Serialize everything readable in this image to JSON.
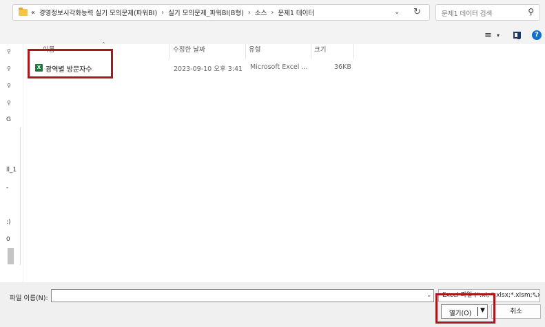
{
  "address": {
    "prefix": "«",
    "crumbs": [
      "경영정보시각화능력 실기 모의문제(파워BI)",
      "실기 모의문제_파워BI(B형)",
      "소스",
      "문제1 데이터"
    ],
    "separator": "›"
  },
  "search": {
    "placeholder": "문제1 데이터 검색"
  },
  "toolbar": {
    "view_icon": "≡",
    "dropdown": "▾",
    "help": "?"
  },
  "nav": {
    "pins": [
      "📌",
      "📌",
      "📌",
      "📌"
    ],
    "fragments": [
      "G",
      "ll_1",
      "-",
      ":)",
      "0"
    ]
  },
  "columns": [
    {
      "label": "이름"
    },
    {
      "label": "수정한 날짜"
    },
    {
      "label": "유형"
    },
    {
      "label": "크기"
    }
  ],
  "files": [
    {
      "name": "광역별 방문자수",
      "modified": "2023-09-10 오후 3:41",
      "type": "Microsoft Excel ...",
      "size": "36KB"
    }
  ],
  "footer": {
    "filename_label": "파일 이름(N):",
    "filename_value": "",
    "filter_text": "Excel 파일 (*.xl; *.xlsx;*.xlsm;*.x",
    "open_label": "열기(O)",
    "cancel_label": "취소"
  },
  "colors": {
    "highlight_box": "#a7181e",
    "excel_icon": "#1f7a3e",
    "help_icon": "#1170cf"
  }
}
